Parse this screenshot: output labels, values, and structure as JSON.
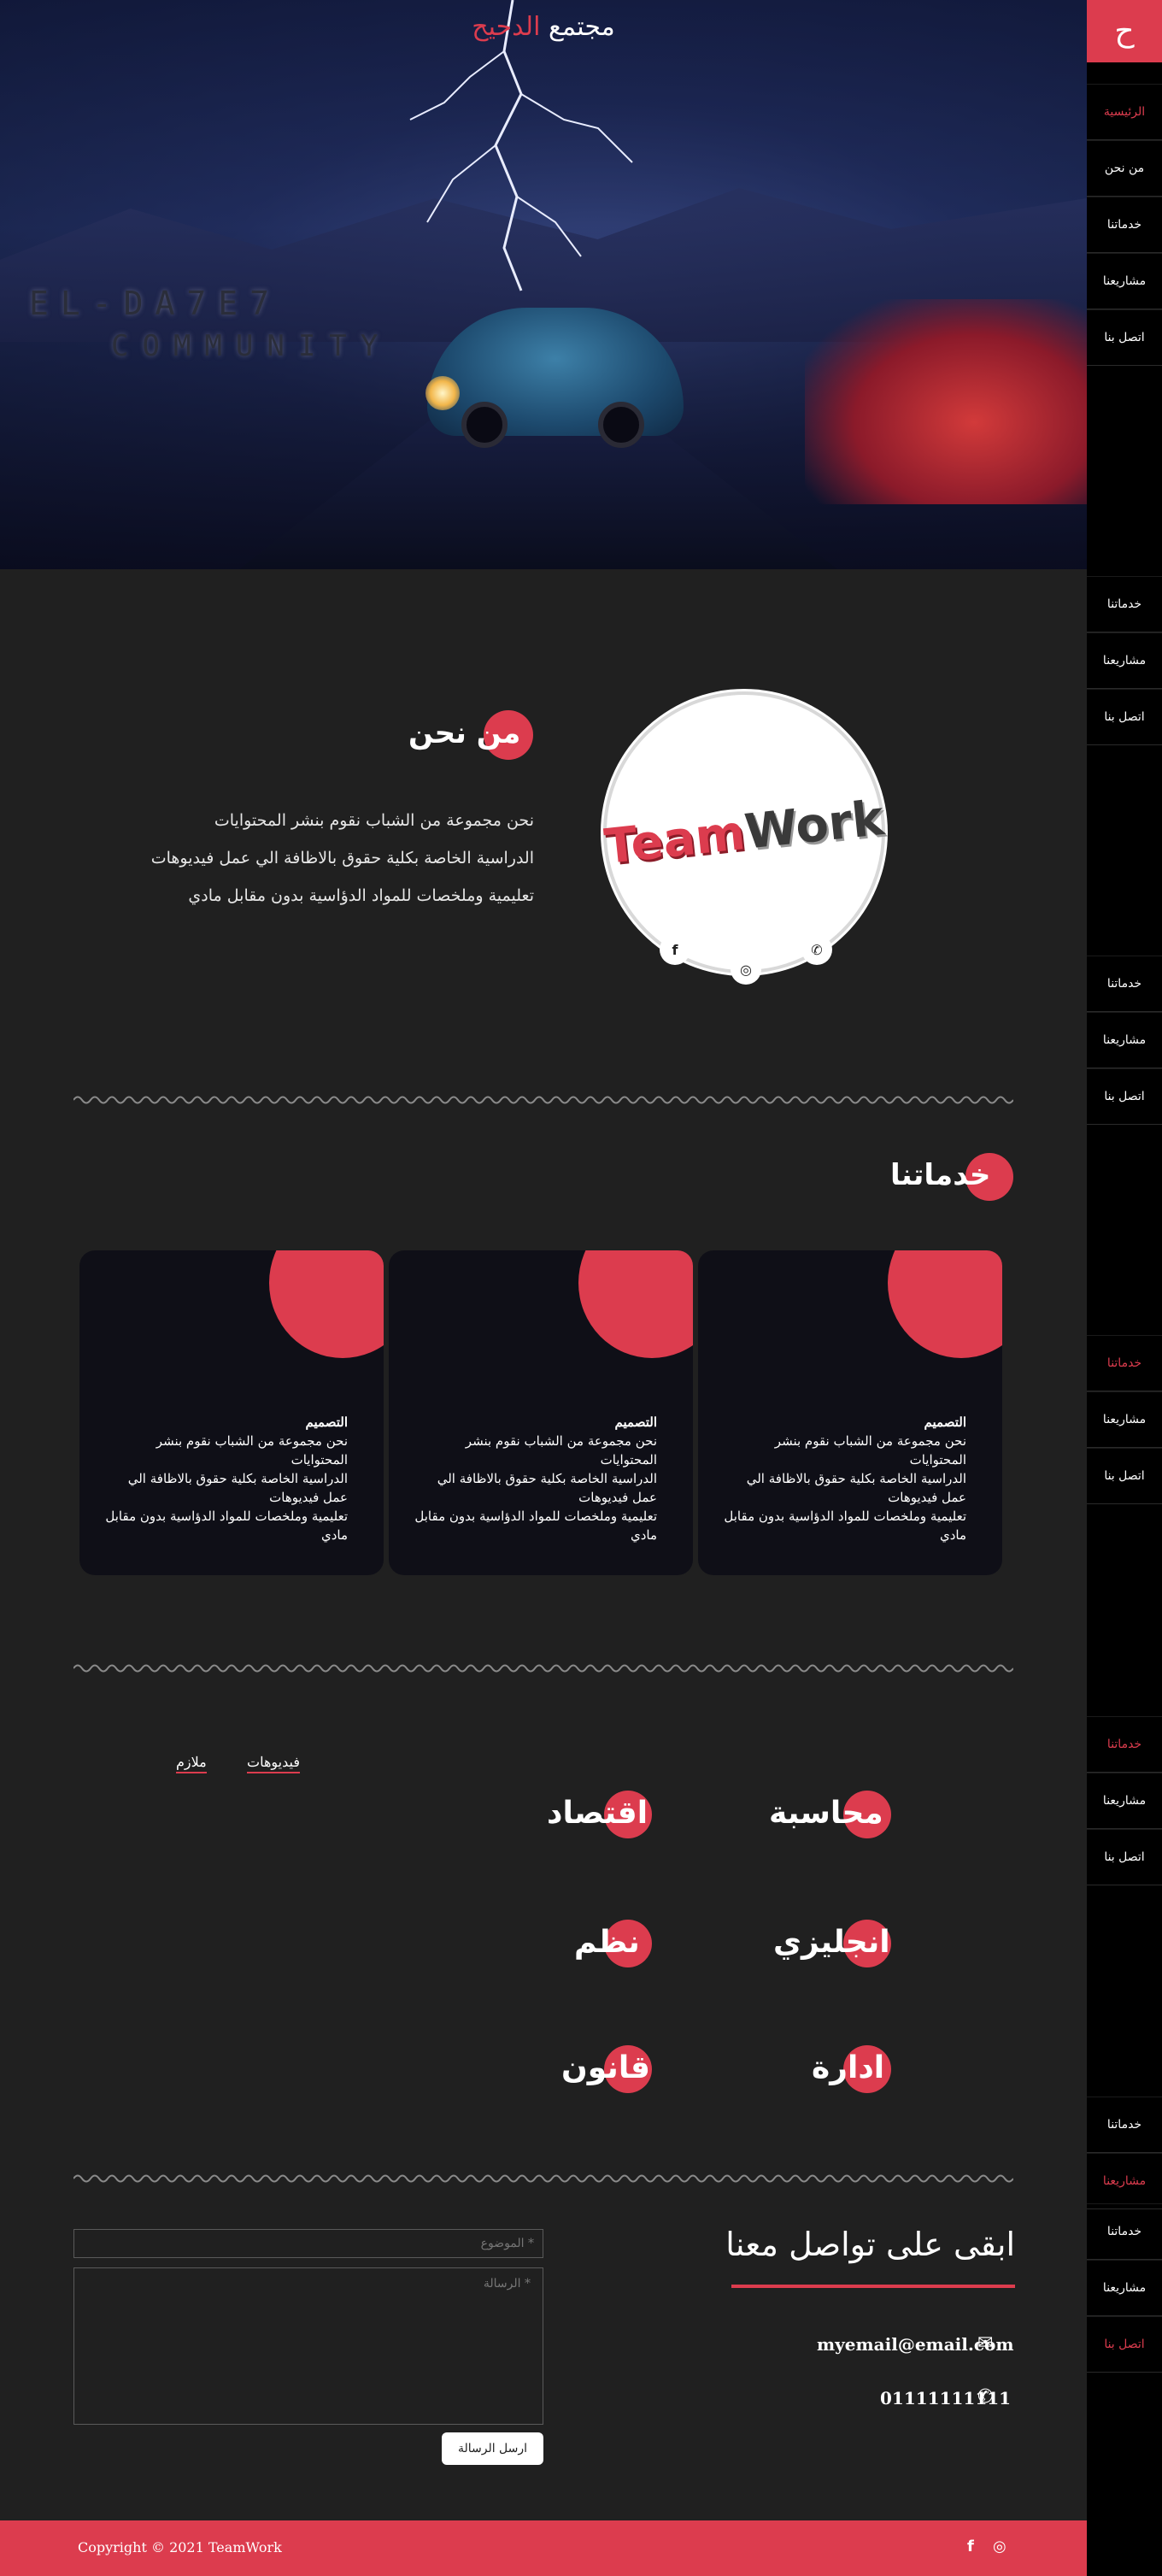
{
  "brand": {
    "logo_letter": "ح",
    "accent": "#dc3c4e",
    "background": "#202020",
    "sidebar_bg": "#000000"
  },
  "hero": {
    "title_prefix": "مجتمع",
    "title_highlight": "الدحيح",
    "image_text_line1": "EL-DA7E7",
    "image_text_line2": "COMMUNITY"
  },
  "sidebar": {
    "items": [
      {
        "label": "الرئيسية"
      },
      {
        "label": "من نحن"
      },
      {
        "label": "خدماتنا"
      },
      {
        "label": "مشاريعنا"
      },
      {
        "label": "اتصل بنا"
      }
    ]
  },
  "about": {
    "heading": "من نحن",
    "lines": [
      "نحن مجموعة من الشباب نقوم بنشر المحتوايات",
      "الدراسية الخاصة بكلية حقوق بالاظافة الي عمل فيديوهات",
      "تعليمية وملخصات للمواد الدؤاسية بدون مقابل مادي"
    ],
    "logo_team": "Team",
    "logo_work": "Work",
    "social_icons": [
      "facebook-icon",
      "instagram-icon",
      "whatsapp-icon"
    ]
  },
  "services": {
    "heading": "خدماتنا",
    "cards": [
      {
        "title": "التصميم",
        "lines": [
          "نحن مجموعة من الشباب نقوم بنشر المحتوايات",
          "الدراسية الخاصة بكلية حقوق بالاظافة الي عمل فيديوهات",
          "تعليمية وملخصات للمواد الدؤاسية بدون مقابل مادي"
        ]
      },
      {
        "title": "التصميم",
        "lines": [
          "نحن مجموعة من الشباب نقوم بنشر المحتوايات",
          "الدراسية الخاصة بكلية حقوق بالاظافة الي عمل فيديوهات",
          "تعليمية وملخصات للمواد الدؤاسية بدون مقابل مادي"
        ]
      },
      {
        "title": "التصميم",
        "lines": [
          "نحن مجموعة من الشباب نقوم بنشر المحتوايات",
          "الدراسية الخاصة بكلية حقوق بالاظافة الي عمل فيديوهات",
          "تعليمية وملخصات للمواد الدؤاسية بدون مقابل مادي"
        ]
      }
    ]
  },
  "projects": {
    "tabs": [
      {
        "label": "فيديوهات"
      },
      {
        "label": "ملازم"
      }
    ],
    "subjects": [
      "محاسبة",
      "اقتصاد",
      "انجليزي",
      "نظم",
      "ادارة",
      "قانون"
    ]
  },
  "contact": {
    "heading": "ابقى على تواصل معنا",
    "email": "myemail@email.com",
    "phone": "01111111111",
    "subject_placeholder": "* الموضوع",
    "message_placeholder": "* الرسالة",
    "send_label": "ارسل الرسالة"
  },
  "footer": {
    "copyright": "Copyright © 2021 TeamWork"
  }
}
